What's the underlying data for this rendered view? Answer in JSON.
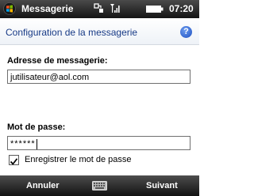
{
  "statusbar": {
    "app_title": "Messagerie",
    "time": "07:20",
    "icons": [
      "windows-start-icon",
      "connectivity-icon",
      "signal-icon",
      "battery-icon"
    ]
  },
  "header": {
    "title": "Configuration de la messagerie",
    "help_icon": "help-icon",
    "help_glyph": "?"
  },
  "form": {
    "email_label": "Adresse de messagerie:",
    "email_value": "jutilisateur@aol.com",
    "password_label": "Mot de passe:",
    "password_value": "******",
    "save_password_label": "Enregistrer le mot de passe",
    "save_password_checked": true
  },
  "softkeys": {
    "left": "Annuler",
    "right": "Suivant",
    "center_icon": "keyboard-icon"
  },
  "colors": {
    "header_text": "#173a86",
    "bar_dark": "#141414"
  }
}
